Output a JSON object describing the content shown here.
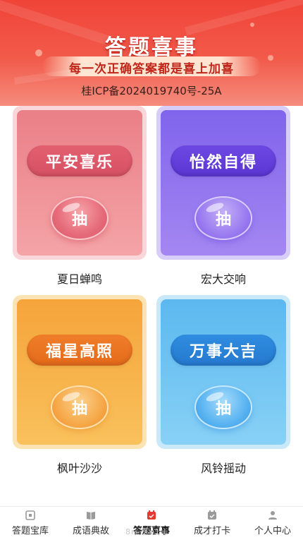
{
  "banner": {
    "title": "答题喜事",
    "subtitle": "每一次正确答案都是喜上加喜",
    "icp": "桂ICP备2024019740号-25A"
  },
  "cards": [
    {
      "theme": "red",
      "pill": "平安喜乐",
      "button": "抽",
      "label": "夏日蝉鸣"
    },
    {
      "theme": "purple",
      "pill": "怡然自得",
      "button": "抽",
      "label": "宏大交响"
    },
    {
      "theme": "orange",
      "pill": "福星高照",
      "button": "抽",
      "label": "枫叶沙沙"
    },
    {
      "theme": "blue",
      "pill": "万事大吉",
      "button": "抽",
      "label": "风铃摇动"
    }
  ],
  "tabbar": {
    "tabs": [
      {
        "label": "答题宝库",
        "icon": "book-box-icon"
      },
      {
        "label": "成语典故",
        "icon": "open-book-icon"
      },
      {
        "label": "答题喜事",
        "icon": "gift-calendar-icon",
        "active": true
      },
      {
        "label": "成才打卡",
        "icon": "checkin-calendar-icon"
      },
      {
        "label": "个人中心",
        "icon": "person-icon"
      }
    ],
    "ghost_text": "8ri 医o1 L"
  },
  "colors": {
    "banner": "#f04438",
    "active_icon": "#e53935"
  }
}
